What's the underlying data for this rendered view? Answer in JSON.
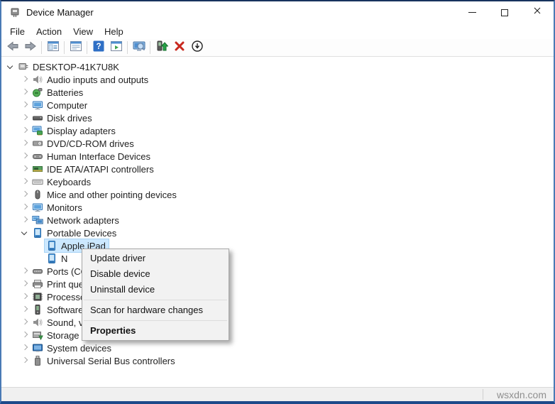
{
  "window": {
    "title": "Device Manager",
    "controls": [
      "minimize",
      "maximize",
      "close"
    ]
  },
  "menu_bar": {
    "items": [
      "File",
      "Action",
      "View",
      "Help"
    ]
  },
  "toolbar": {
    "buttons": [
      "back",
      "forward",
      "show-console-tree",
      "properties-panel",
      "help",
      "action-window",
      "scan-hardware-changes",
      "update-driver",
      "uninstall-device",
      "disable-device"
    ]
  },
  "tree": {
    "items": [
      {
        "label": "DESKTOP-41K7U8K",
        "icon": "computer-root",
        "level": 0,
        "expand": "expanded"
      },
      {
        "label": "Audio inputs and outputs",
        "icon": "speaker",
        "level": 1,
        "expand": "collapsed"
      },
      {
        "label": "Batteries",
        "icon": "battery",
        "level": 1,
        "expand": "collapsed"
      },
      {
        "label": "Computer",
        "icon": "monitor",
        "level": 1,
        "expand": "collapsed"
      },
      {
        "label": "Disk drives",
        "icon": "hdd",
        "level": 1,
        "expand": "collapsed"
      },
      {
        "label": "Display adapters",
        "icon": "display-adapter",
        "level": 1,
        "expand": "collapsed"
      },
      {
        "label": "DVD/CD-ROM drives",
        "icon": "dvd",
        "level": 1,
        "expand": "collapsed"
      },
      {
        "label": "Human Interface Devices",
        "icon": "hid",
        "level": 1,
        "expand": "collapsed"
      },
      {
        "label": "IDE ATA/ATAPI controllers",
        "icon": "ide",
        "level": 1,
        "expand": "collapsed"
      },
      {
        "label": "Keyboards",
        "icon": "keyboard",
        "level": 1,
        "expand": "collapsed"
      },
      {
        "label": "Mice and other pointing devices",
        "icon": "mouse",
        "level": 1,
        "expand": "collapsed"
      },
      {
        "label": "Monitors",
        "icon": "monitor",
        "level": 1,
        "expand": "collapsed"
      },
      {
        "label": "Network adapters",
        "icon": "network",
        "level": 1,
        "expand": "collapsed"
      },
      {
        "label": "Portable Devices",
        "icon": "portable",
        "level": 1,
        "expand": "expanded"
      },
      {
        "label": "Apple iPad",
        "icon": "portable",
        "level": 2,
        "expand": "none",
        "selected": true
      },
      {
        "label": "N",
        "icon": "portable",
        "level": 2,
        "expand": "none"
      },
      {
        "label": "Ports (COM & LPT)",
        "icon": "ports",
        "level": 1,
        "expand": "collapsed"
      },
      {
        "label": "Print queues",
        "icon": "printer",
        "level": 1,
        "expand": "collapsed"
      },
      {
        "label": "Processors",
        "icon": "cpu",
        "level": 1,
        "expand": "collapsed"
      },
      {
        "label": "Software devices",
        "icon": "software",
        "level": 1,
        "expand": "collapsed"
      },
      {
        "label": "Sound, video and game controllers",
        "icon": "sound",
        "level": 1,
        "expand": "collapsed"
      },
      {
        "label": "Storage controllers",
        "icon": "storage",
        "level": 1,
        "expand": "collapsed"
      },
      {
        "label": "System devices",
        "icon": "system",
        "level": 1,
        "expand": "collapsed"
      },
      {
        "label": "Universal Serial Bus controllers",
        "icon": "usb",
        "level": 1,
        "expand": "collapsed"
      }
    ]
  },
  "context_menu": {
    "items": [
      {
        "label": "Update driver"
      },
      {
        "label": "Disable device"
      },
      {
        "label": "Uninstall device"
      },
      {
        "type": "separator"
      },
      {
        "label": "Scan for hardware changes"
      },
      {
        "type": "separator"
      },
      {
        "label": "Properties",
        "bold": true
      }
    ]
  },
  "status_bar": {
    "watermark": "wsxdn.com"
  },
  "colors": {
    "window_border_top": "#17335e",
    "window_border_side": "#4a7ab5",
    "selection_highlight": "#cce8ff",
    "menu_background": "#f2f2f2",
    "watermark_text": "#8f8f8f",
    "uninstall_red": "#c8281e",
    "update_green": "#27a348",
    "help_blue": "#2e6fc5"
  }
}
